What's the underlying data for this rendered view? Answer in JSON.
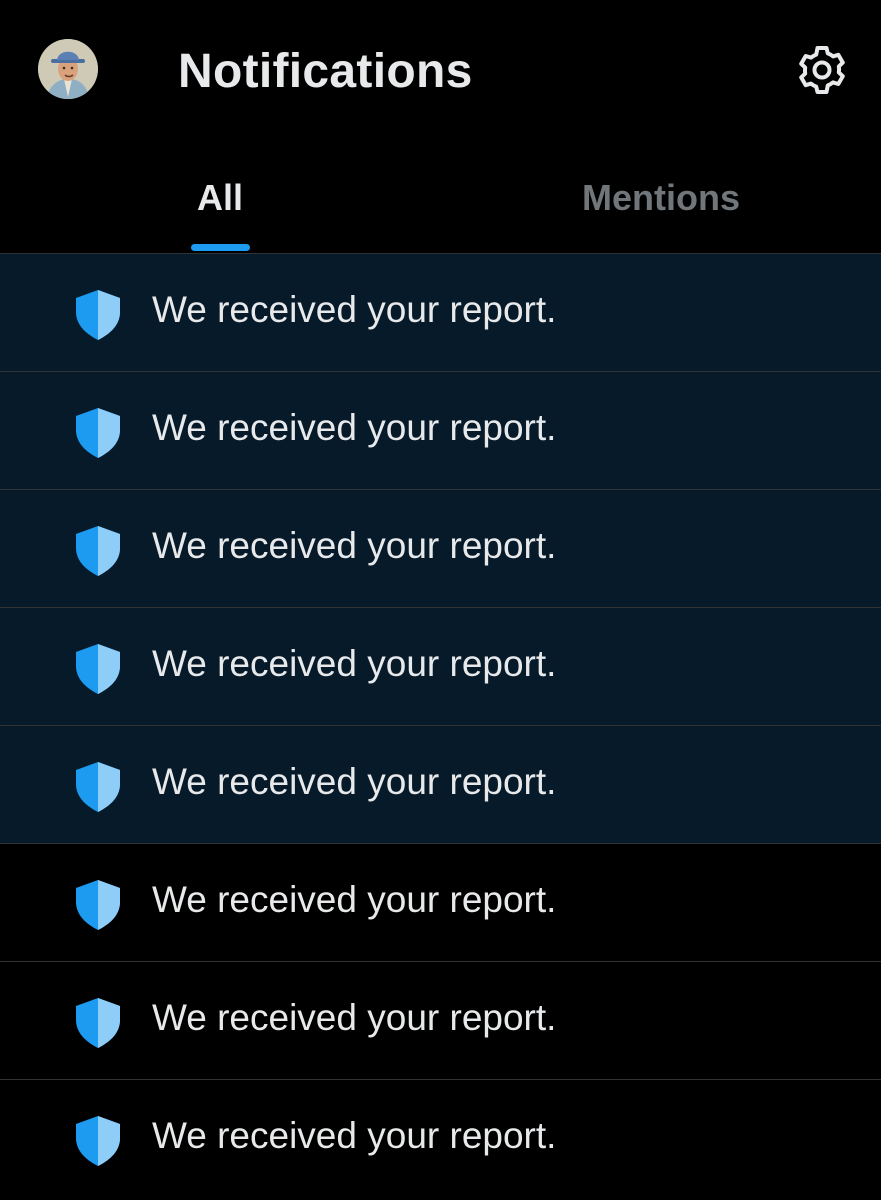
{
  "header": {
    "title": "Notifications",
    "avatar_icon": "user-avatar",
    "settings_icon": "gear-icon"
  },
  "tabs": [
    {
      "label": "All",
      "selected": true
    },
    {
      "label": "Mentions",
      "selected": false
    }
  ],
  "notifications": [
    {
      "icon": "shield-icon",
      "text": "We received your report.",
      "unread": true
    },
    {
      "icon": "shield-icon",
      "text": "We received your report.",
      "unread": true
    },
    {
      "icon": "shield-icon",
      "text": "We received your report.",
      "unread": true
    },
    {
      "icon": "shield-icon",
      "text": "We received your report.",
      "unread": true
    },
    {
      "icon": "shield-icon",
      "text": "We received your report.",
      "unread": true
    },
    {
      "icon": "shield-icon",
      "text": "We received your report.",
      "unread": false
    },
    {
      "icon": "shield-icon",
      "text": "We received your report.",
      "unread": false
    },
    {
      "icon": "shield-icon",
      "text": "We received your report.",
      "unread": false
    }
  ],
  "colors": {
    "background": "#000000",
    "unread_row": "#071a2a",
    "accent": "#1d9bf0",
    "shield_light": "#8ecdf8",
    "text_primary": "#e7e9ea",
    "text_secondary": "#71767b",
    "divider": "#2f3336"
  }
}
